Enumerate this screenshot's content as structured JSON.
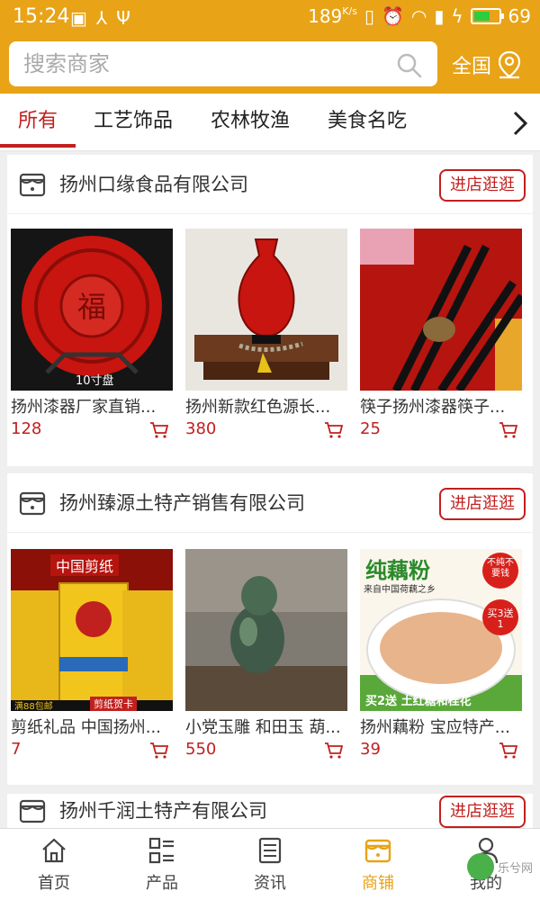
{
  "status_bar": {
    "time": "15:24",
    "speed": "189",
    "speed_unit": "K/s",
    "battery": "69",
    "battery_level": 0.69
  },
  "search": {
    "placeholder": "搜索商家",
    "region_label": "全国"
  },
  "tabs": [
    {
      "label": "所有",
      "active": true
    },
    {
      "label": "工艺饰品",
      "active": false
    },
    {
      "label": "农林牧渔",
      "active": false
    },
    {
      "label": "美食名吃",
      "active": false
    }
  ],
  "shops": [
    {
      "name": "扬州口缘食品有限公司",
      "visit_label": "进店逛逛",
      "products": [
        {
          "title": "扬州漆器厂家直销...",
          "price": "128",
          "badge": "10寸盘"
        },
        {
          "title": "扬州新款红色源长...",
          "price": "380"
        },
        {
          "title": "筷子扬州漆器筷子...",
          "price": "25"
        }
      ]
    },
    {
      "name": "扬州臻源土特产销售有限公司",
      "visit_label": "进店逛逛",
      "products": [
        {
          "title": "剪纸礼品 中国扬州...",
          "price": "7",
          "image_text_top": "中国剪纸",
          "image_text_bottom_left": "满88包邮",
          "image_text_bottom_right": "剪纸贺卡"
        },
        {
          "title": "小党玉雕 和田玉 葫...",
          "price": "550"
        },
        {
          "title": "扬州藕粉 宝应特产...",
          "price": "39",
          "image_text_top": "纯藕粉",
          "image_text_sub": "来自中国荷藕之乡",
          "image_badge_1": "不纯不要钱",
          "image_badge_2": "买3送1",
          "image_text_bottom": "买2送 土红糖和桂花"
        }
      ]
    },
    {
      "name": "扬州千润土特产有限公司",
      "visit_label": "进店逛逛"
    }
  ],
  "bottom_nav": [
    {
      "label": "首页",
      "icon": "home-icon",
      "active": false
    },
    {
      "label": "产品",
      "icon": "grid-list-icon",
      "active": false
    },
    {
      "label": "资讯",
      "icon": "news-icon",
      "active": false
    },
    {
      "label": "商铺",
      "icon": "shop-icon",
      "active": true
    },
    {
      "label": "我的",
      "icon": "user-icon",
      "active": false
    }
  ],
  "watermark": "乐兮网",
  "colors": {
    "brand": "#e8a317",
    "accent": "#c0201e"
  }
}
